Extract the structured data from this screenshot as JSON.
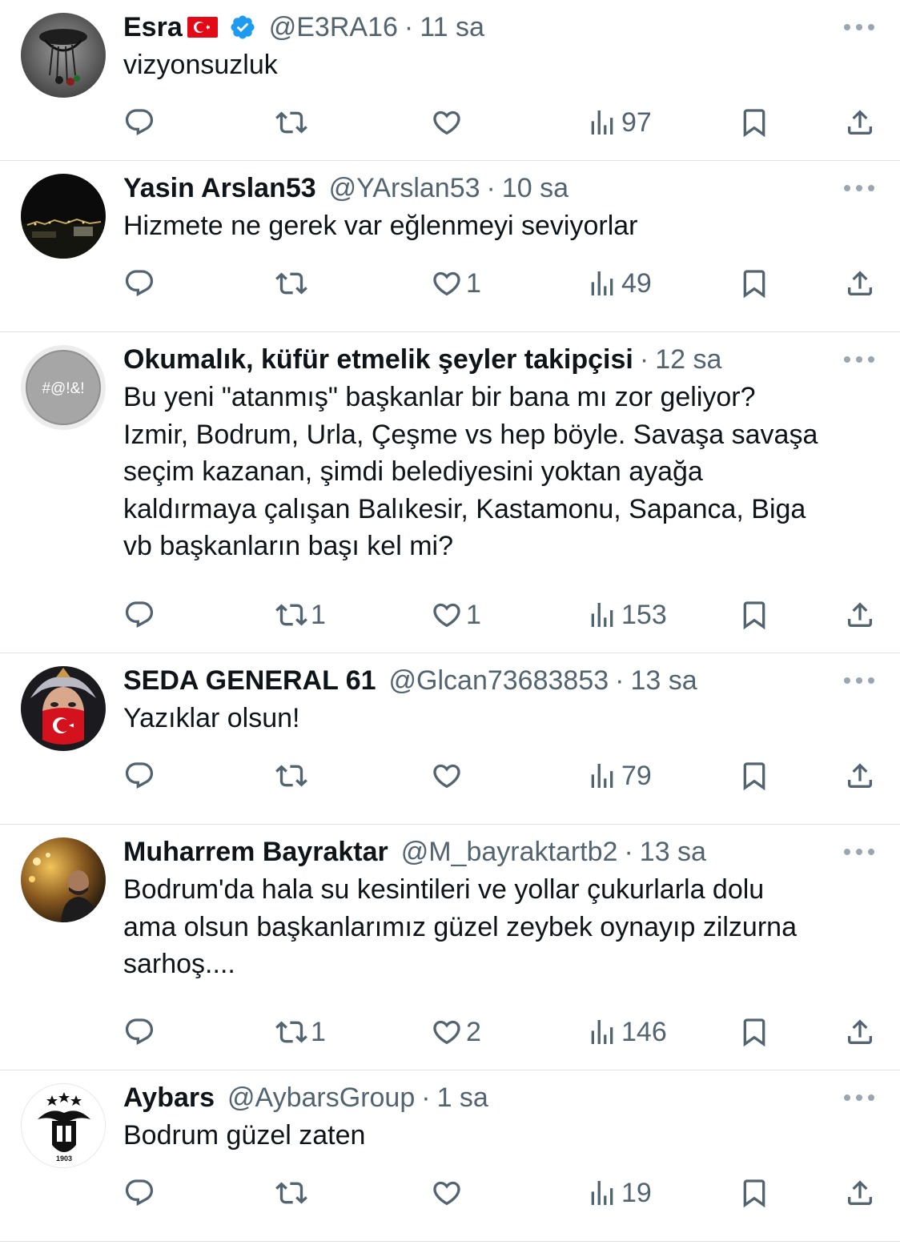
{
  "tweets": [
    {
      "name": "Esra",
      "has_flag": true,
      "verified": true,
      "handle": "@E3RA16",
      "time": "11 sa",
      "text_lines": [
        "vizyonsuzluk"
      ],
      "replies": "",
      "retweets": "",
      "likes": "",
      "views": "97",
      "avatar": "esra-avatar"
    },
    {
      "name": "Yasin Arslan53",
      "has_flag": false,
      "verified": false,
      "handle": "@YArslan53",
      "time": "10 sa",
      "text_lines": [
        "Hizmete ne gerek var eğlenmeyi seviyorlar"
      ],
      "replies": "",
      "retweets": "",
      "likes": "1",
      "views": "49",
      "avatar": "night-city-avatar"
    },
    {
      "name": "Okumalık, küfür etmelik şeyler takipçisi",
      "has_flag": false,
      "verified": false,
      "handle": "",
      "time": "12 sa",
      "text_lines": [
        "Bu yeni \"atanmış\" başkanlar bir bana mı zor geliyor?",
        "Izmir, Bodrum, Urla, Çeşme vs hep böyle. Savaşa savaşa",
        "seçim kazanan, şimdi belediyesini yoktan ayağa",
        "kaldırmaya çalışan Balıkesir, Kastamonu, Sapanca, Biga",
        "vb başkanların başı kel mi?"
      ],
      "replies": "",
      "retweets": "1",
      "likes": "1",
      "views": "153",
      "avatar": "symbols-avatar",
      "avatar_text": "#@!&!"
    },
    {
      "name": "SEDA GENERAL 61",
      "has_flag": false,
      "verified": false,
      "handle": "@Glcan73683853",
      "time": "13 sa",
      "text_lines": [
        "Yazıklar olsun!"
      ],
      "replies": "",
      "retweets": "",
      "likes": "",
      "views": "79",
      "avatar": "warrior-avatar"
    },
    {
      "name": "Muharrem Bayraktar",
      "has_flag": false,
      "verified": false,
      "handle": "@M_bayraktartb2",
      "time": "13 sa",
      "text_lines": [
        "Bodrum'da hala su kesintileri ve yollar çukurlarla dolu",
        "ama olsun başkanlarımız güzel zeybek oynayıp zilzurna",
        "sarhoş...."
      ],
      "replies": "",
      "retweets": "1",
      "likes": "2",
      "views": "146",
      "avatar": "person-avatar"
    },
    {
      "name": "Aybars",
      "has_flag": false,
      "verified": false,
      "handle": "@AybarsGroup",
      "time": "1 sa",
      "text_lines": [
        "Bodrum güzel zaten"
      ],
      "replies": "",
      "retweets": "",
      "likes": "",
      "views": "19",
      "avatar": "eagle-crest-avatar",
      "avatar_text": "1903"
    }
  ],
  "separator": "·",
  "colors": {
    "text": "#0f1419",
    "secondary": "#536471",
    "verified": "#1d9bf0",
    "divider": "#dfe3e6",
    "flag_red": "#e30a17"
  },
  "icons": [
    "reply-icon",
    "retweet-icon",
    "like-icon",
    "views-icon",
    "bookmark-icon",
    "share-icon",
    "more-icon",
    "verified-icon",
    "turkey-flag-icon"
  ]
}
